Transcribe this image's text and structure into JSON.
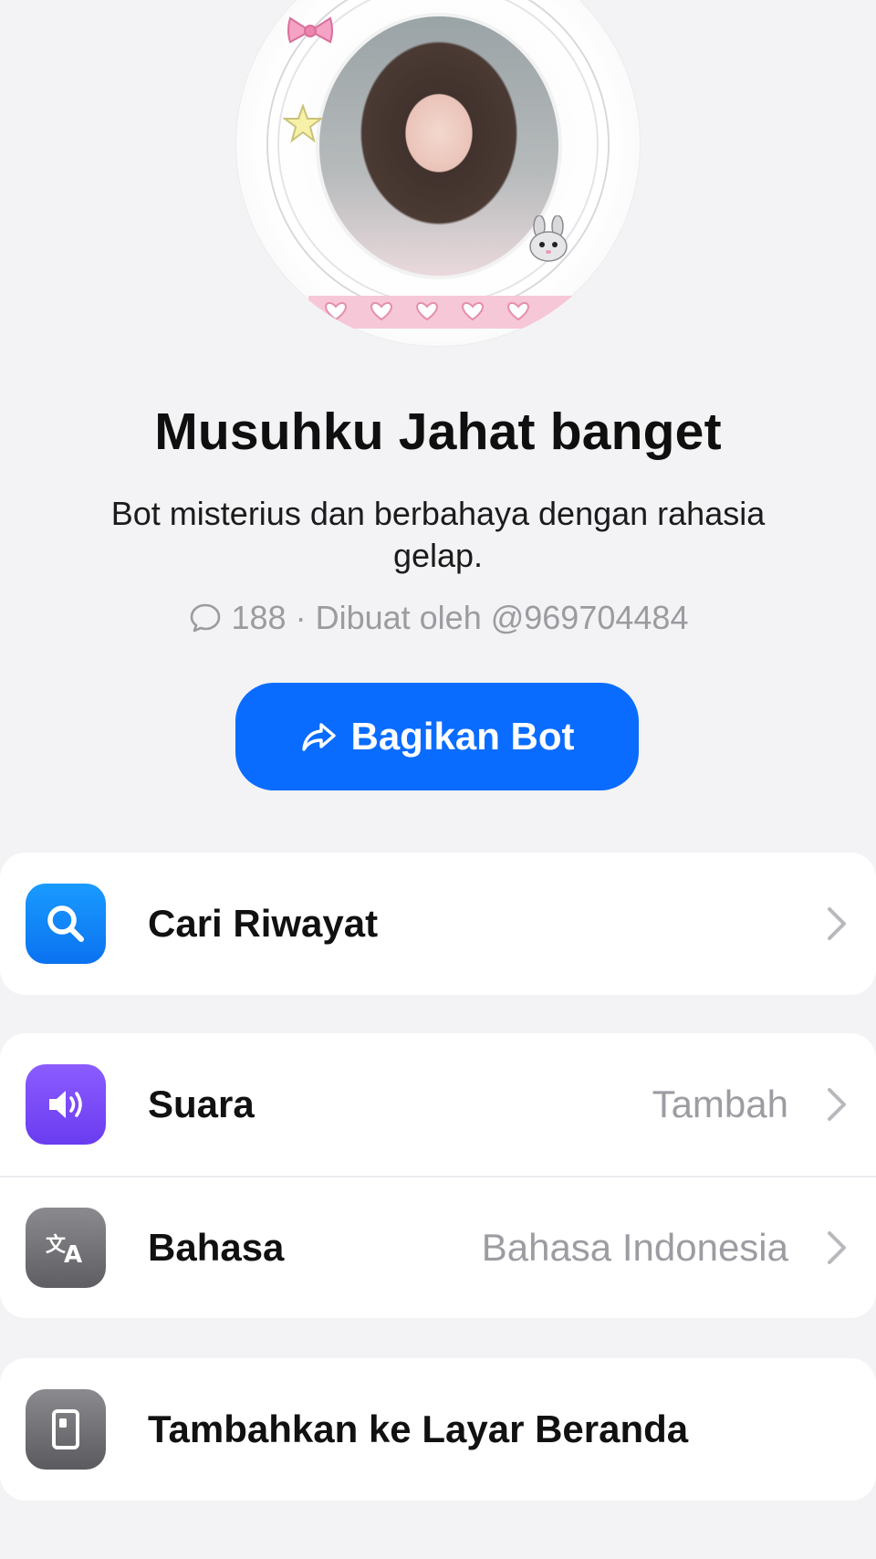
{
  "profile": {
    "name": "Musuhku Jahat banget",
    "description": "Bot misterius dan berbahaya dengan rahasia gelap.",
    "chat_count": "188",
    "separator": "·",
    "creator": "Dibuat oleh @969704484"
  },
  "share_button": {
    "label": "Bagikan Bot"
  },
  "menu": {
    "search_history": {
      "label": "Cari Riwayat",
      "icon": "search-icon"
    },
    "voice": {
      "label": "Suara",
      "value": "Tambah",
      "icon": "speaker-icon"
    },
    "language": {
      "label": "Bahasa",
      "value": "Bahasa Indonesia",
      "icon": "translate-icon"
    },
    "add_home": {
      "label": "Tambahkan ke Layar Beranda",
      "icon": "phone-icon"
    }
  },
  "colors": {
    "accent": "#0a6cff",
    "background": "#f3f3f5",
    "muted_text": "#9c9ca2"
  }
}
